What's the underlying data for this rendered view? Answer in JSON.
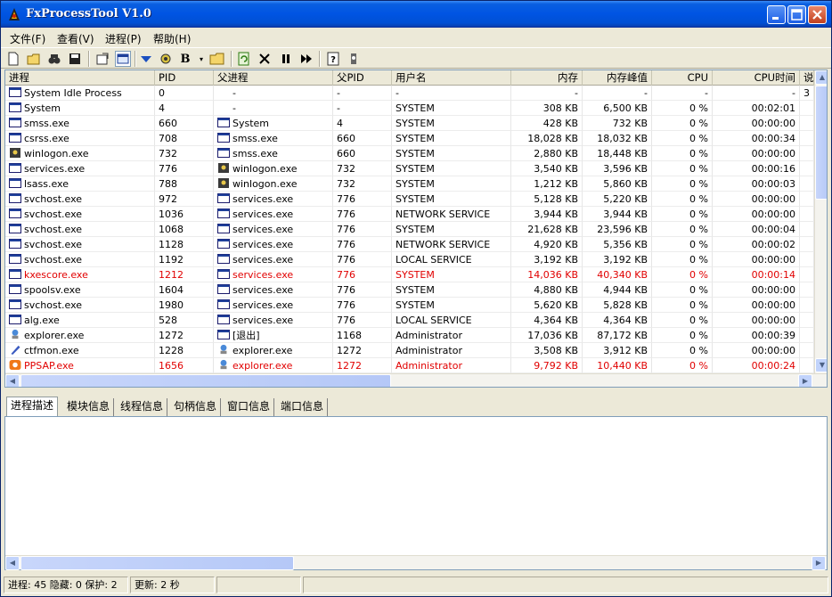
{
  "window": {
    "title": "FxProcessTool V1.0"
  },
  "menu": [
    {
      "label": "文件(F)"
    },
    {
      "label": "查看(V)"
    },
    {
      "label": "进程(P)"
    },
    {
      "label": "帮助(H)"
    }
  ],
  "toolbar": {
    "buttons": [
      "new-icon",
      "open-folder-icon",
      "find-icon",
      "save-icon",
      "properties-icon",
      "window-view-icon",
      "down-arrow-icon",
      "gear-icon",
      "bold-b-icon",
      "folder-icon",
      "refresh-icon",
      "kill-icon",
      "pause-icon",
      "resume-icon",
      "help-icon",
      "about-icon"
    ],
    "b_label": "B"
  },
  "columns": [
    "进程",
    "PID",
    "父进程",
    "父PID",
    "用户名",
    "内存",
    "内存峰值",
    "CPU",
    "CPU时间",
    "说"
  ],
  "processes": [
    {
      "name": "System Idle Process",
      "icon": "window-icon",
      "pid": "0",
      "parent": "-",
      "parent_icon": "",
      "ppid": "-",
      "user": "-",
      "mem": "-",
      "peak": "-",
      "cpu": "-",
      "time": "-",
      "extra": "3",
      "hl": false
    },
    {
      "name": "System",
      "icon": "window-icon",
      "pid": "4",
      "parent": "-",
      "parent_icon": "",
      "ppid": "-",
      "user": "SYSTEM",
      "mem": "308 KB",
      "peak": "6,500 KB",
      "cpu": "0 %",
      "time": "00:02:01",
      "extra": "",
      "hl": false
    },
    {
      "name": "smss.exe",
      "icon": "window-icon",
      "pid": "660",
      "parent": "System",
      "parent_icon": "window-icon",
      "ppid": "4",
      "user": "SYSTEM",
      "mem": "428 KB",
      "peak": "732 KB",
      "cpu": "0 %",
      "time": "00:00:00",
      "extra": "",
      "hl": false
    },
    {
      "name": "csrss.exe",
      "icon": "window-icon",
      "pid": "708",
      "parent": "smss.exe",
      "parent_icon": "window-icon",
      "ppid": "660",
      "user": "SYSTEM",
      "mem": "18,028 KB",
      "peak": "18,032 KB",
      "cpu": "0 %",
      "time": "00:00:34",
      "extra": "",
      "hl": false
    },
    {
      "name": "winlogon.exe",
      "icon": "winlogon-icon",
      "pid": "732",
      "parent": "smss.exe",
      "parent_icon": "window-icon",
      "ppid": "660",
      "user": "SYSTEM",
      "mem": "2,880 KB",
      "peak": "18,448 KB",
      "cpu": "0 %",
      "time": "00:00:00",
      "extra": "",
      "hl": false
    },
    {
      "name": "services.exe",
      "icon": "window-icon",
      "pid": "776",
      "parent": "winlogon.exe",
      "parent_icon": "winlogon-icon",
      "ppid": "732",
      "user": "SYSTEM",
      "mem": "3,540 KB",
      "peak": "3,596 KB",
      "cpu": "0 %",
      "time": "00:00:16",
      "extra": "",
      "hl": false
    },
    {
      "name": "lsass.exe",
      "icon": "window-icon",
      "pid": "788",
      "parent": "winlogon.exe",
      "parent_icon": "winlogon-icon",
      "ppid": "732",
      "user": "SYSTEM",
      "mem": "1,212 KB",
      "peak": "5,860 KB",
      "cpu": "0 %",
      "time": "00:00:03",
      "extra": "",
      "hl": false
    },
    {
      "name": "svchost.exe",
      "icon": "window-icon",
      "pid": "972",
      "parent": "services.exe",
      "parent_icon": "window-icon",
      "ppid": "776",
      "user": "SYSTEM",
      "mem": "5,128 KB",
      "peak": "5,220 KB",
      "cpu": "0 %",
      "time": "00:00:00",
      "extra": "",
      "hl": false
    },
    {
      "name": "svchost.exe",
      "icon": "window-icon",
      "pid": "1036",
      "parent": "services.exe",
      "parent_icon": "window-icon",
      "ppid": "776",
      "user": "NETWORK SERVICE",
      "mem": "3,944 KB",
      "peak": "3,944 KB",
      "cpu": "0 %",
      "time": "00:00:00",
      "extra": "",
      "hl": false
    },
    {
      "name": "svchost.exe",
      "icon": "window-icon",
      "pid": "1068",
      "parent": "services.exe",
      "parent_icon": "window-icon",
      "ppid": "776",
      "user": "SYSTEM",
      "mem": "21,628 KB",
      "peak": "23,596 KB",
      "cpu": "0 %",
      "time": "00:00:04",
      "extra": "",
      "hl": false
    },
    {
      "name": "svchost.exe",
      "icon": "window-icon",
      "pid": "1128",
      "parent": "services.exe",
      "parent_icon": "window-icon",
      "ppid": "776",
      "user": "NETWORK SERVICE",
      "mem": "4,920 KB",
      "peak": "5,356 KB",
      "cpu": "0 %",
      "time": "00:00:02",
      "extra": "",
      "hl": false
    },
    {
      "name": "svchost.exe",
      "icon": "window-icon",
      "pid": "1192",
      "parent": "services.exe",
      "parent_icon": "window-icon",
      "ppid": "776",
      "user": "LOCAL SERVICE",
      "mem": "3,192 KB",
      "peak": "3,192 KB",
      "cpu": "0 %",
      "time": "00:00:00",
      "extra": "",
      "hl": false
    },
    {
      "name": "kxescore.exe",
      "icon": "window-icon",
      "pid": "1212",
      "parent": "services.exe",
      "parent_icon": "window-icon",
      "ppid": "776",
      "user": "SYSTEM",
      "mem": "14,036 KB",
      "peak": "40,340 KB",
      "cpu": "0 %",
      "time": "00:00:14",
      "extra": "",
      "hl": true
    },
    {
      "name": "spoolsv.exe",
      "icon": "window-icon",
      "pid": "1604",
      "parent": "services.exe",
      "parent_icon": "window-icon",
      "ppid": "776",
      "user": "SYSTEM",
      "mem": "4,880 KB",
      "peak": "4,944 KB",
      "cpu": "0 %",
      "time": "00:00:00",
      "extra": "",
      "hl": false
    },
    {
      "name": "svchost.exe",
      "icon": "window-icon",
      "pid": "1980",
      "parent": "services.exe",
      "parent_icon": "window-icon",
      "ppid": "776",
      "user": "SYSTEM",
      "mem": "5,620 KB",
      "peak": "5,828 KB",
      "cpu": "0 %",
      "time": "00:00:00",
      "extra": "",
      "hl": false
    },
    {
      "name": "alg.exe",
      "icon": "window-icon",
      "pid": "528",
      "parent": "services.exe",
      "parent_icon": "window-icon",
      "ppid": "776",
      "user": "LOCAL SERVICE",
      "mem": "4,364 KB",
      "peak": "4,364 KB",
      "cpu": "0 %",
      "time": "00:00:00",
      "extra": "",
      "hl": false
    },
    {
      "name": "explorer.exe",
      "icon": "explorer-icon",
      "pid": "1272",
      "parent": "[退出]",
      "parent_icon": "window-icon",
      "ppid": "1168",
      "user": "Administrator",
      "mem": "17,036 KB",
      "peak": "87,172 KB",
      "cpu": "0 %",
      "time": "00:00:39",
      "extra": "",
      "hl": false
    },
    {
      "name": "ctfmon.exe",
      "icon": "pen-icon",
      "pid": "1228",
      "parent": "explorer.exe",
      "parent_icon": "explorer-icon",
      "ppid": "1272",
      "user": "Administrator",
      "mem": "3,508 KB",
      "peak": "3,912 KB",
      "cpu": "0 %",
      "time": "00:00:00",
      "extra": "",
      "hl": false
    },
    {
      "name": "PPSAP.exe",
      "icon": "pps-icon",
      "pid": "1656",
      "parent": "explorer.exe",
      "parent_icon": "explorer-icon",
      "ppid": "1272",
      "user": "Administrator",
      "mem": "9,792 KB",
      "peak": "10,440 KB",
      "cpu": "0 %",
      "time": "00:00:24",
      "extra": "",
      "hl": true
    }
  ],
  "tabs": [
    {
      "label": "进程描述",
      "active": true
    },
    {
      "label": "模块信息",
      "active": false
    },
    {
      "label": "线程信息",
      "active": false
    },
    {
      "label": "句柄信息",
      "active": false
    },
    {
      "label": "窗口信息",
      "active": false
    },
    {
      "label": "端口信息",
      "active": false
    }
  ],
  "status": {
    "processes": "进程: 45  隐藏: 0  保护: 2",
    "refresh": "更新: 2 秒"
  },
  "colors": {
    "highlight": "#e10000",
    "title_blue": "#0054e3"
  }
}
